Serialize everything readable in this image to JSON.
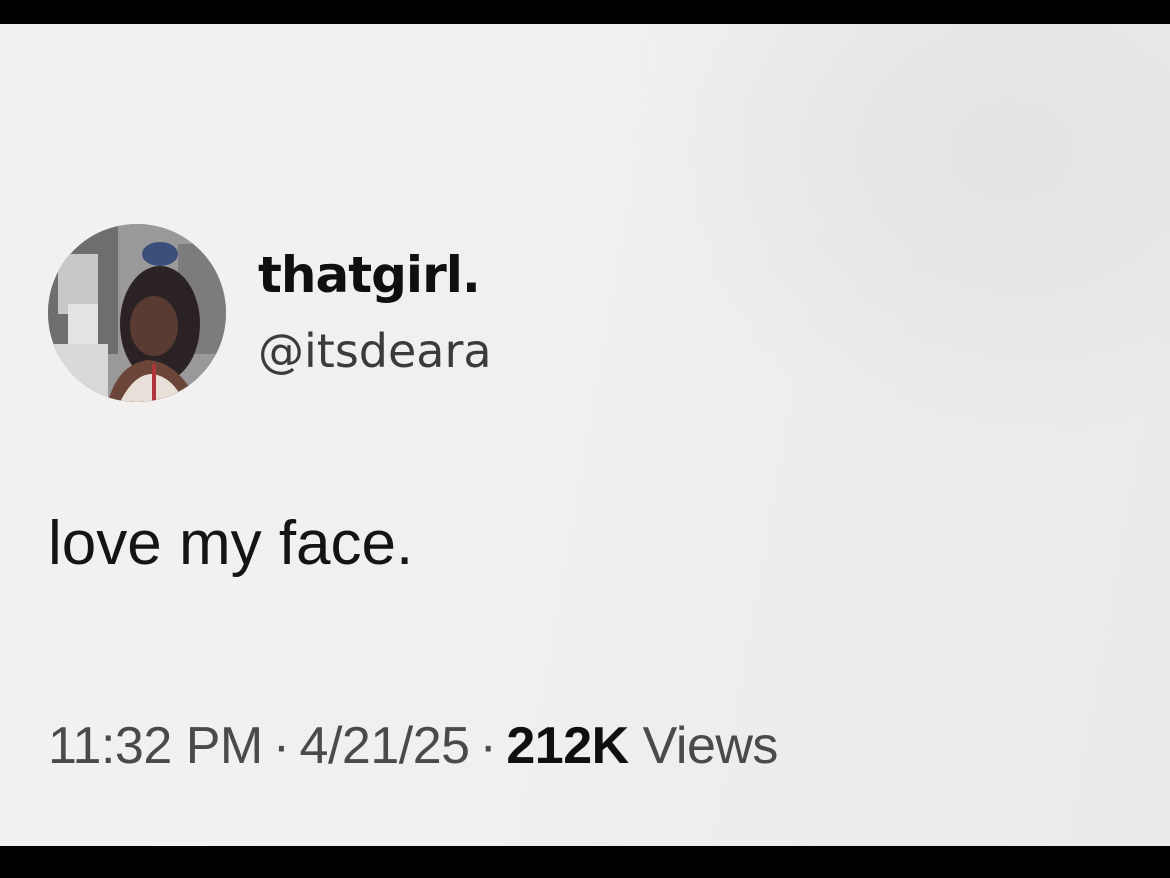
{
  "tweet": {
    "display_name": "thatgirl.",
    "handle": "@itsdeara",
    "text": "love my face.",
    "time": "11:32 PM",
    "date": "4/21/25",
    "separator": "·",
    "views_count": "212K",
    "views_label": "Views"
  },
  "avatar": {
    "icon": "profile-photo"
  }
}
